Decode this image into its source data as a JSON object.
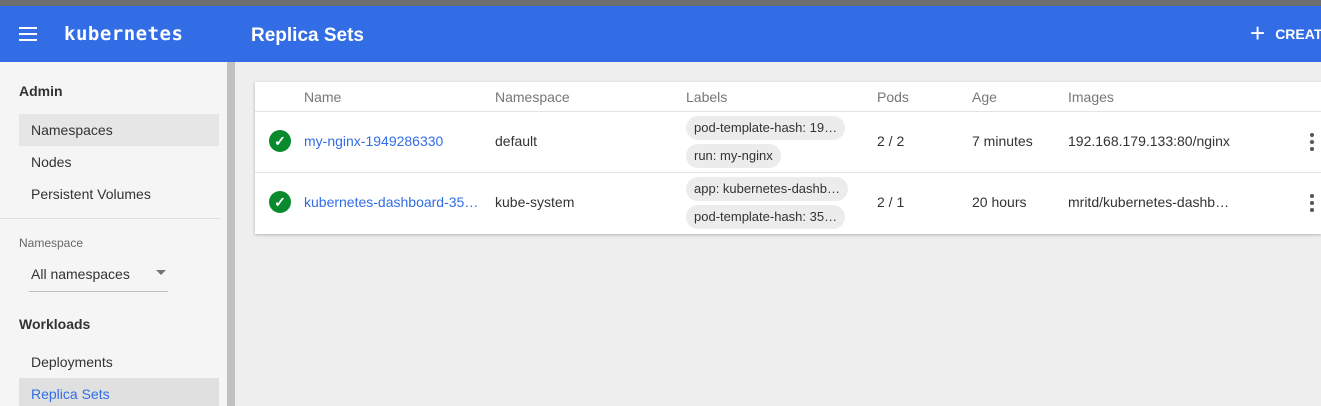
{
  "app": {
    "brand": "kubernetes",
    "page_title": "Replica Sets",
    "create_label": "CREATE",
    "accent": "#326de6"
  },
  "sidebar": {
    "admin_title": "Admin",
    "admin_items": [
      "Namespaces",
      "Nodes",
      "Persistent Volumes"
    ],
    "namespace_caption": "Namespace",
    "namespace_value": "All namespaces",
    "workloads_title": "Workloads",
    "workload_items": [
      "Deployments",
      "Replica Sets"
    ]
  },
  "table": {
    "headers": {
      "name": "Name",
      "namespace": "Namespace",
      "labels": "Labels",
      "pods": "Pods",
      "age": "Age",
      "images": "Images"
    },
    "rows": [
      {
        "status": "success",
        "name": "my-nginx-1949286330",
        "namespace": "default",
        "labels": [
          "pod-template-hash: 19…",
          "run: my-nginx"
        ],
        "pods": "2 / 2",
        "age": "7 minutes",
        "images": "192.168.179.133:80/nginx"
      },
      {
        "status": "success",
        "name": "kubernetes-dashboard-35…",
        "namespace": "kube-system",
        "labels": [
          "app: kubernetes-dashb…",
          "pod-template-hash: 35…"
        ],
        "pods": "2 / 1",
        "age": "20 hours",
        "images": "mritd/kubernetes-dashb…"
      }
    ]
  }
}
